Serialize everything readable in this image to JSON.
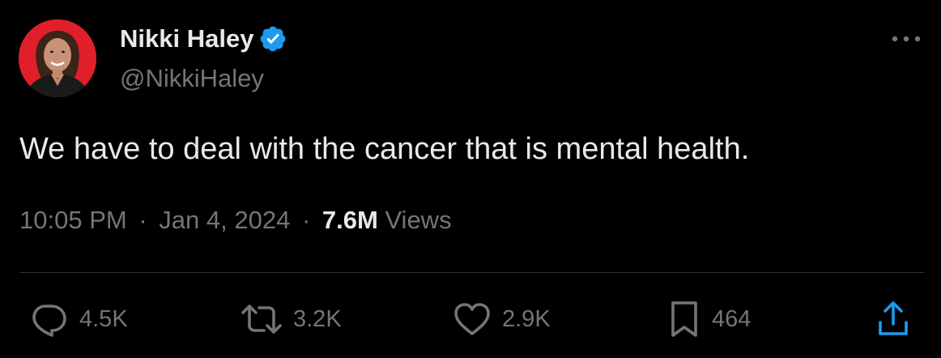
{
  "author": {
    "display_name": "Nikki Haley",
    "handle": "@NikkiHaley",
    "verified": true,
    "avatar_icon": "profile-photo",
    "avatar_background": "#e01f2b",
    "verified_color": "#1d9bf0"
  },
  "menu": {
    "icon": "more-horizontal-icon"
  },
  "tweet": {
    "text": "We have to deal with the cancer that is mental health."
  },
  "meta": {
    "time": "10:05 PM",
    "separator1": "·",
    "date": "Jan 4, 2024",
    "separator2": "·",
    "views_count": "7.6M",
    "views_label": "Views"
  },
  "actions": {
    "reply": {
      "icon": "reply-icon",
      "count": "4.5K"
    },
    "repost": {
      "icon": "repost-icon",
      "count": "3.2K"
    },
    "like": {
      "icon": "heart-icon",
      "count": "2.9K"
    },
    "bookmark": {
      "icon": "bookmark-icon",
      "count": "464"
    },
    "share": {
      "icon": "share-icon"
    }
  },
  "colors": {
    "background": "#000000",
    "primary_text": "#e7e9ea",
    "secondary_text": "#71767b",
    "divider": "#2f3336"
  }
}
